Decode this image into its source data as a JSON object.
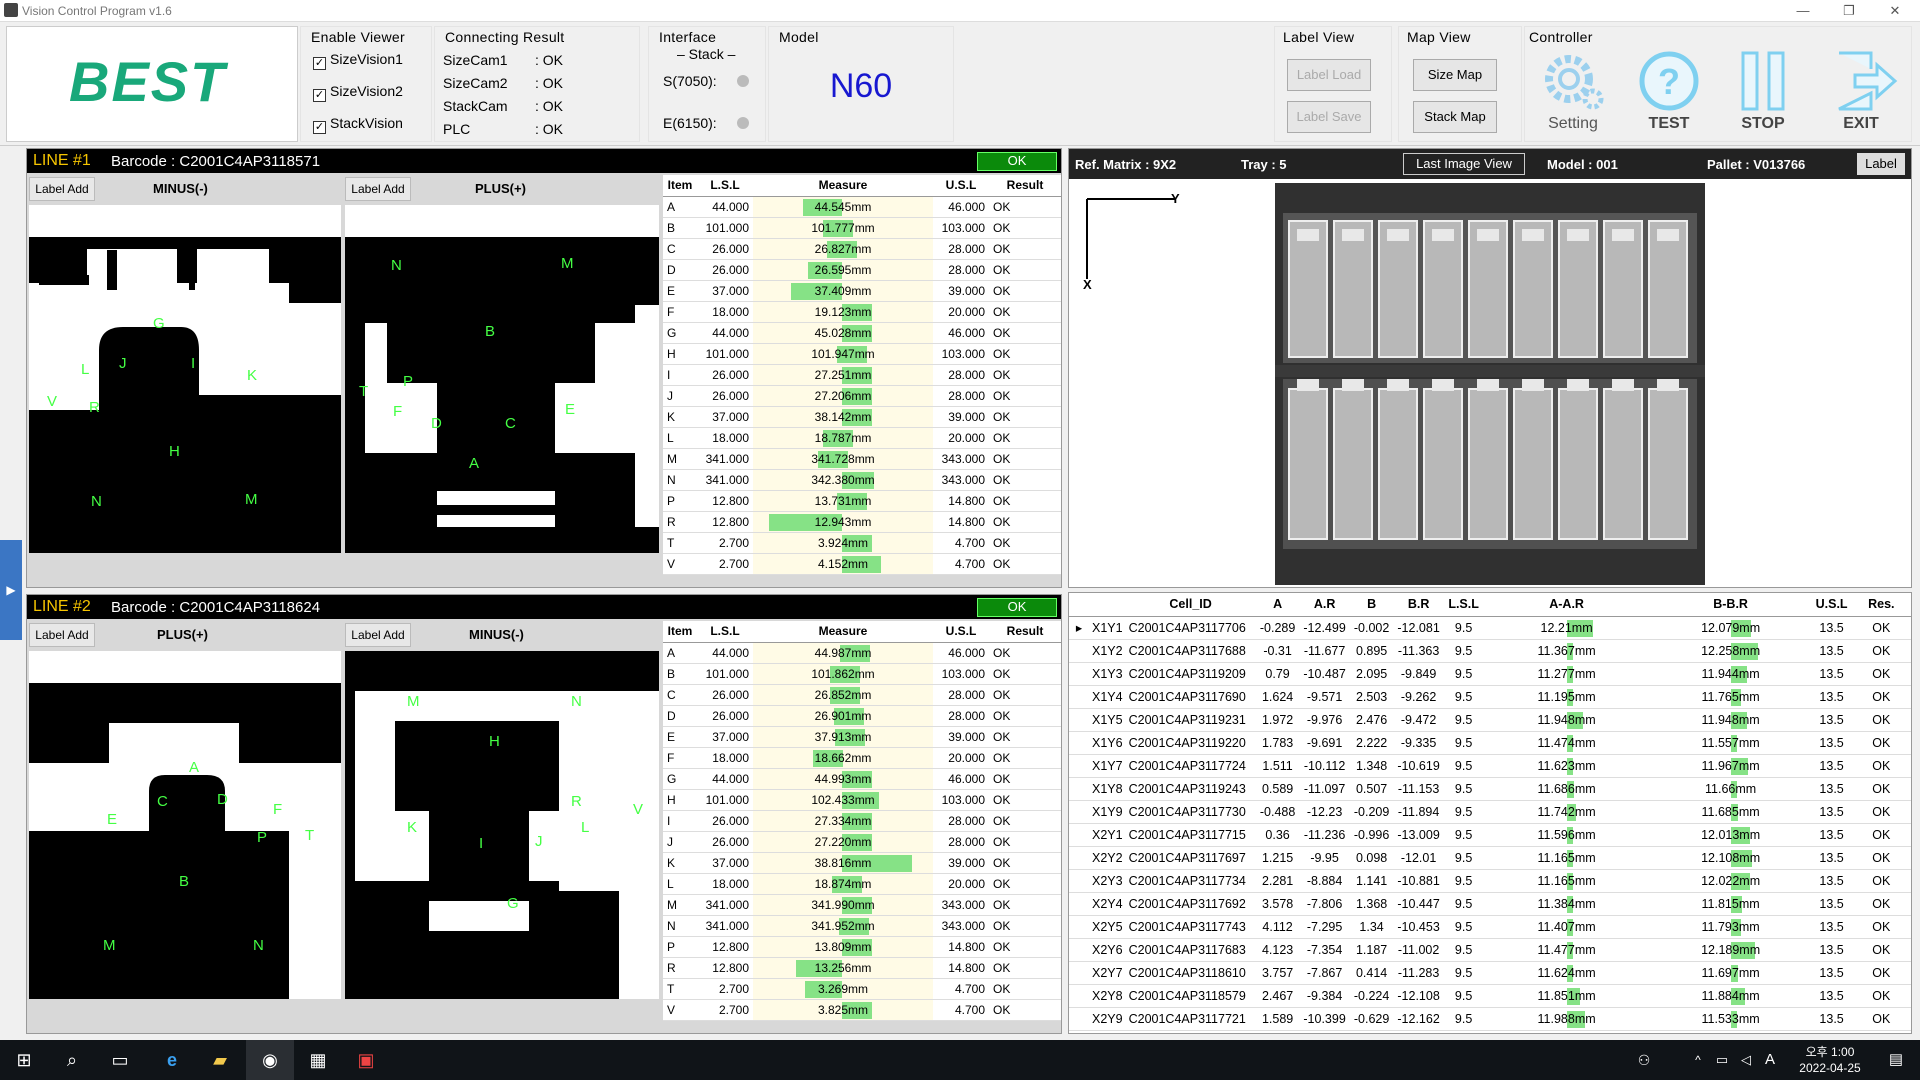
{
  "window": {
    "title": "Vision Control Program v1.6",
    "min": "—",
    "max": "❐",
    "close": "✕"
  },
  "logo": "BEST",
  "enable_viewer": {
    "title": "Enable Viewer",
    "items": [
      "SizeVision1",
      "SizeVision2",
      "StackVision"
    ]
  },
  "connecting": {
    "title": "Connecting Result",
    "rows": [
      [
        "SizeCam1",
        ": OK"
      ],
      [
        "SizeCam2",
        ": OK"
      ],
      [
        "StackCam",
        ": OK"
      ],
      [
        "PLC",
        ": OK"
      ]
    ]
  },
  "interface": {
    "title": "Interface",
    "sub": "– Stack –",
    "s": "S(7050):",
    "e": "E(6150):"
  },
  "model": {
    "title": "Model",
    "value": "N60"
  },
  "label_view": {
    "title": "Label View",
    "load": "Label Load",
    "save": "Label Save"
  },
  "map_view": {
    "title": "Map View",
    "size": "Size Map",
    "stack": "Stack Map"
  },
  "controller": {
    "title": "Controller",
    "setting": "Setting",
    "test": "TEST",
    "stop": "STOP",
    "exit": "EXIT"
  },
  "line1": {
    "label": "LINE #1",
    "barcode": "Barcode : C2001C4AP3118571",
    "result": "OK",
    "btn_a": "Label Add",
    "cap_a": "MINUS(-)",
    "btn_b": "Label Add",
    "cap_b": "PLUS(+)",
    "img_a_labels": [
      "G",
      "J",
      "I",
      "L",
      "K",
      "V",
      "R",
      "H",
      "N",
      "M"
    ],
    "img_b_labels": [
      "N",
      "M",
      "B",
      "P",
      "T",
      "F",
      "E",
      "D",
      "C",
      "A"
    ],
    "headers": [
      "Item",
      "L.S.L",
      "Measure",
      "U.S.L",
      "Result"
    ],
    "rows": [
      [
        "A",
        "44.000",
        "44.545mm",
        "46.000",
        "OK",
        0.27
      ],
      [
        "B",
        "101.000",
        "101.777mm",
        "103.000",
        "OK",
        0.39
      ],
      [
        "C",
        "26.000",
        "26.827mm",
        "28.000",
        "OK",
        0.41
      ],
      [
        "D",
        "26.000",
        "26.595mm",
        "28.000",
        "OK",
        0.3
      ],
      [
        "E",
        "37.000",
        "37.409mm",
        "39.000",
        "OK",
        0.2
      ],
      [
        "F",
        "18.000",
        "19.123mm",
        "20.000",
        "OK",
        0.56
      ],
      [
        "G",
        "44.000",
        "45.028mm",
        "46.000",
        "OK",
        0.51
      ],
      [
        "H",
        "101.000",
        "101.947mm",
        "103.000",
        "OK",
        0.47
      ],
      [
        "I",
        "26.000",
        "27.251mm",
        "28.000",
        "OK",
        0.63
      ],
      [
        "J",
        "26.000",
        "27.206mm",
        "28.000",
        "OK",
        0.6
      ],
      [
        "K",
        "37.000",
        "38.142mm",
        "39.000",
        "OK",
        0.57
      ],
      [
        "L",
        "18.000",
        "18.787mm",
        "20.000",
        "OK",
        0.39
      ],
      [
        "M",
        "341.000",
        "341.728mm",
        "343.000",
        "OK",
        0.36
      ],
      [
        "N",
        "341.000",
        "342.380mm",
        "343.000",
        "OK",
        0.69
      ],
      [
        "P",
        "12.800",
        "13.731mm",
        "14.800",
        "OK",
        0.47
      ],
      [
        "R",
        "12.800",
        "12.943mm",
        "14.800",
        "OK",
        0.07
      ],
      [
        "T",
        "2.700",
        "3.924mm",
        "4.700",
        "OK",
        0.61
      ],
      [
        "V",
        "2.700",
        "4.152mm",
        "4.700",
        "OK",
        0.73
      ]
    ]
  },
  "line2": {
    "label": "LINE #2",
    "barcode": "Barcode : C2001C4AP3118624",
    "result": "OK",
    "btn_a": "Label Add",
    "cap_a": "PLUS(+)",
    "btn_b": "Label Add",
    "cap_b": "MINUS(-)",
    "img_a_labels": [
      "A",
      "C",
      "D",
      "F",
      "E",
      "P",
      "T",
      "B",
      "M",
      "N"
    ],
    "img_b_labels": [
      "M",
      "N",
      "H",
      "R",
      "V",
      "K",
      "I",
      "J",
      "L",
      "G"
    ],
    "headers": [
      "Item",
      "L.S.L",
      "Measure",
      "U.S.L",
      "Result"
    ],
    "rows": [
      [
        "A",
        "44.000",
        "44.987mm",
        "46.000",
        "OK",
        0.49
      ],
      [
        "B",
        "101.000",
        "101.862mm",
        "103.000",
        "OK",
        0.43
      ],
      [
        "C",
        "26.000",
        "26.852mm",
        "28.000",
        "OK",
        0.43
      ],
      [
        "D",
        "26.000",
        "26.901mm",
        "28.000",
        "OK",
        0.45
      ],
      [
        "E",
        "37.000",
        "37.913mm",
        "39.000",
        "OK",
        0.46
      ],
      [
        "F",
        "18.000",
        "18.662mm",
        "20.000",
        "OK",
        0.33
      ],
      [
        "G",
        "44.000",
        "44.993mm",
        "46.000",
        "OK",
        0.5
      ],
      [
        "H",
        "101.000",
        "102.433mm",
        "103.000",
        "OK",
        0.72
      ],
      [
        "I",
        "26.000",
        "27.334mm",
        "28.000",
        "OK",
        0.67
      ],
      [
        "J",
        "26.000",
        "27.220mm",
        "28.000",
        "OK",
        0.61
      ],
      [
        "K",
        "37.000",
        "38.816mm",
        "39.000",
        "OK",
        0.91
      ],
      [
        "L",
        "18.000",
        "18.874mm",
        "20.000",
        "OK",
        0.44
      ],
      [
        "M",
        "341.000",
        "341.990mm",
        "343.000",
        "OK",
        0.5
      ],
      [
        "N",
        "341.000",
        "341.952mm",
        "343.000",
        "OK",
        0.48
      ],
      [
        "P",
        "12.800",
        "13.809mm",
        "14.800",
        "OK",
        0.5
      ],
      [
        "R",
        "12.800",
        "13.256mm",
        "14.800",
        "OK",
        0.23
      ],
      [
        "T",
        "2.700",
        "3.269mm",
        "4.700",
        "OK",
        0.28
      ],
      [
        "V",
        "2.700",
        "3.825mm",
        "4.700",
        "OK",
        0.56
      ]
    ]
  },
  "stack": {
    "ref": "Ref. Matrix : 9X2",
    "tray": "Tray : 5",
    "last": "Last Image View",
    "model": "Model : 001",
    "pallet": "Pallet : V013766",
    "label_btn": "Label",
    "axis_y": "Y",
    "axis_x": "X"
  },
  "cells": {
    "headers": [
      "Cell_ID",
      "A",
      "A.R",
      "B",
      "B.R",
      "L.S.L",
      "A-A.R",
      "B-B.R",
      "U.S.L",
      "Res."
    ],
    "rows": [
      [
        "X1Y1",
        "C2001C4AP3117706",
        "-0.289",
        "-12.499",
        "-0.002",
        "-12.081",
        "9.5",
        "12.21mm",
        "12.079mm",
        "13.5",
        "OK",
        0.68,
        0.64
      ],
      [
        "X1Y2",
        "C2001C4AP3117688",
        "-0.31",
        "-11.677",
        "0.895",
        "-11.363",
        "9.5",
        "11.367mm",
        "12.258mm",
        "13.5",
        "OK",
        0.47,
        0.69
      ],
      [
        "X1Y3",
        "C2001C4AP3119209",
        "0.79",
        "-10.487",
        "2.095",
        "-9.849",
        "9.5",
        "11.277mm",
        "11.944mm",
        "13.5",
        "OK",
        0.44,
        0.61
      ],
      [
        "X1Y4",
        "C2001C4AP3117690",
        "1.624",
        "-9.571",
        "2.503",
        "-9.262",
        "9.5",
        "11.195mm",
        "11.765mm",
        "13.5",
        "OK",
        0.42,
        0.57
      ],
      [
        "X1Y5",
        "C2001C4AP3119231",
        "1.972",
        "-9.976",
        "2.476",
        "-9.472",
        "9.5",
        "11.948mm",
        "11.948mm",
        "13.5",
        "OK",
        0.61,
        0.61
      ],
      [
        "X1Y6",
        "C2001C4AP3119220",
        "1.783",
        "-9.691",
        "2.222",
        "-9.335",
        "9.5",
        "11.474mm",
        "11.557mm",
        "13.5",
        "OK",
        0.49,
        0.51
      ],
      [
        "X1Y7",
        "C2001C4AP3117724",
        "1.511",
        "-10.112",
        "1.348",
        "-10.619",
        "9.5",
        "11.623mm",
        "11.967mm",
        "13.5",
        "OK",
        0.53,
        0.62
      ],
      [
        "X1Y8",
        "C2001C4AP3119243",
        "0.589",
        "-11.097",
        "0.507",
        "-11.153",
        "9.5",
        "11.686mm",
        "11.66mm",
        "13.5",
        "OK",
        0.55,
        0.54
      ],
      [
        "X1Y9",
        "C2001C4AP3117730",
        "-0.488",
        "-12.23",
        "-0.209",
        "-11.894",
        "9.5",
        "11.742mm",
        "11.685mm",
        "13.5",
        "OK",
        0.56,
        0.55
      ],
      [
        "X2Y1",
        "C2001C4AP3117715",
        "0.36",
        "-11.236",
        "-0.996",
        "-13.009",
        "9.5",
        "11.596mm",
        "12.013mm",
        "13.5",
        "OK",
        0.52,
        0.63
      ],
      [
        "X2Y2",
        "C2001C4AP3117697",
        "1.215",
        "-9.95",
        "0.098",
        "-12.01",
        "9.5",
        "11.165mm",
        "12.108mm",
        "13.5",
        "OK",
        0.42,
        0.65
      ],
      [
        "X2Y3",
        "C2001C4AP3117734",
        "2.281",
        "-8.884",
        "1.141",
        "-10.881",
        "9.5",
        "11.165mm",
        "12.022mm",
        "13.5",
        "OK",
        0.42,
        0.63
      ],
      [
        "X2Y4",
        "C2001C4AP3117692",
        "3.578",
        "-7.806",
        "1.368",
        "-10.447",
        "9.5",
        "11.384mm",
        "11.815mm",
        "13.5",
        "OK",
        0.47,
        0.58
      ],
      [
        "X2Y5",
        "C2001C4AP3117743",
        "4.112",
        "-7.295",
        "1.34",
        "-10.453",
        "9.5",
        "11.407mm",
        "11.793mm",
        "13.5",
        "OK",
        0.48,
        0.57
      ],
      [
        "X2Y6",
        "C2001C4AP3117683",
        "4.123",
        "-7.354",
        "1.187",
        "-11.002",
        "9.5",
        "11.477mm",
        "12.189mm",
        "13.5",
        "OK",
        0.49,
        0.67
      ],
      [
        "X2Y7",
        "C2001C4AP3118610",
        "3.757",
        "-7.867",
        "0.414",
        "-11.283",
        "9.5",
        "11.624mm",
        "11.697mm",
        "13.5",
        "OK",
        0.53,
        0.55
      ],
      [
        "X2Y8",
        "C2001C4AP3118579",
        "2.467",
        "-9.384",
        "-0.224",
        "-12.108",
        "9.5",
        "11.851mm",
        "11.884mm",
        "13.5",
        "OK",
        0.59,
        0.6
      ],
      [
        "X2Y9",
        "C2001C4AP3117721",
        "1.589",
        "-10.399",
        "-0.629",
        "-12.162",
        "9.5",
        "11.988mm",
        "11.533mm",
        "13.5",
        "OK",
        0.62,
        0.51
      ]
    ]
  },
  "taskbar": {
    "time": "오후 1:00",
    "date": "2022-04-25",
    "ime": "A"
  }
}
